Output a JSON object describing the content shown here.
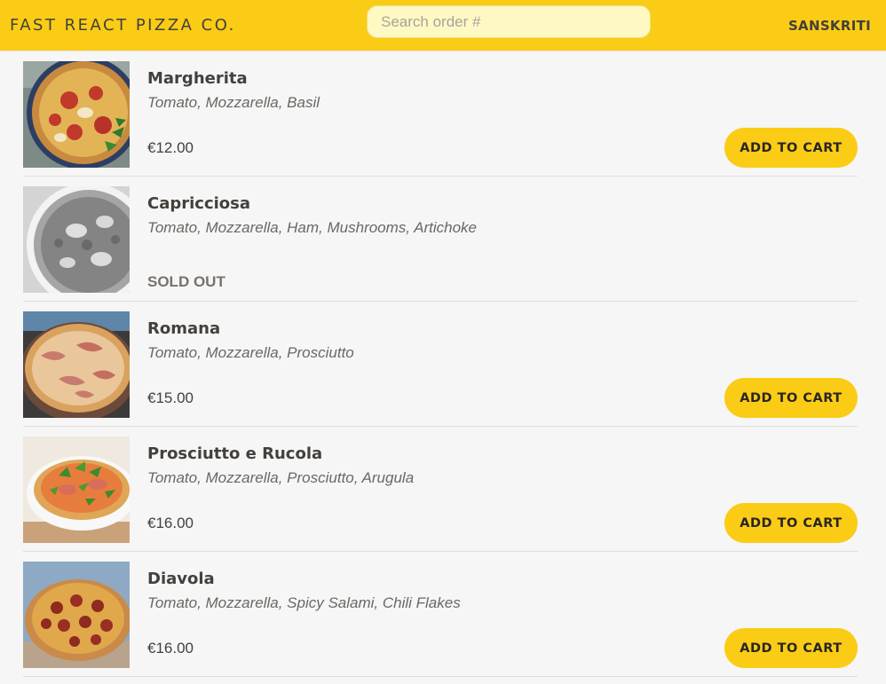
{
  "header": {
    "logo": "FAST REACT PIZZA CO.",
    "search_placeholder": "Search order #",
    "username": "SANSKRITI"
  },
  "menu": {
    "add_label": "ADD TO CART",
    "sold_out_label": "SOLD OUT",
    "items": [
      {
        "name": "Margherita",
        "ingredients": "Tomato, Mozzarella, Basil",
        "price": "€12.00",
        "sold_out": false
      },
      {
        "name": "Capricciosa",
        "ingredients": "Tomato, Mozzarella, Ham, Mushrooms, Artichoke",
        "price": "",
        "sold_out": true
      },
      {
        "name": "Romana",
        "ingredients": "Tomato, Mozzarella, Prosciutto",
        "price": "€15.00",
        "sold_out": false
      },
      {
        "name": "Prosciutto e Rucola",
        "ingredients": "Tomato, Mozzarella, Prosciutto, Arugula",
        "price": "€16.00",
        "sold_out": false
      },
      {
        "name": "Diavola",
        "ingredients": "Tomato, Mozzarella, Spicy Salami, Chili Flakes",
        "price": "€16.00",
        "sold_out": false
      }
    ]
  },
  "colors": {
    "accent": "#facc15",
    "background": "#f6f6f6",
    "text": "#44403c"
  }
}
